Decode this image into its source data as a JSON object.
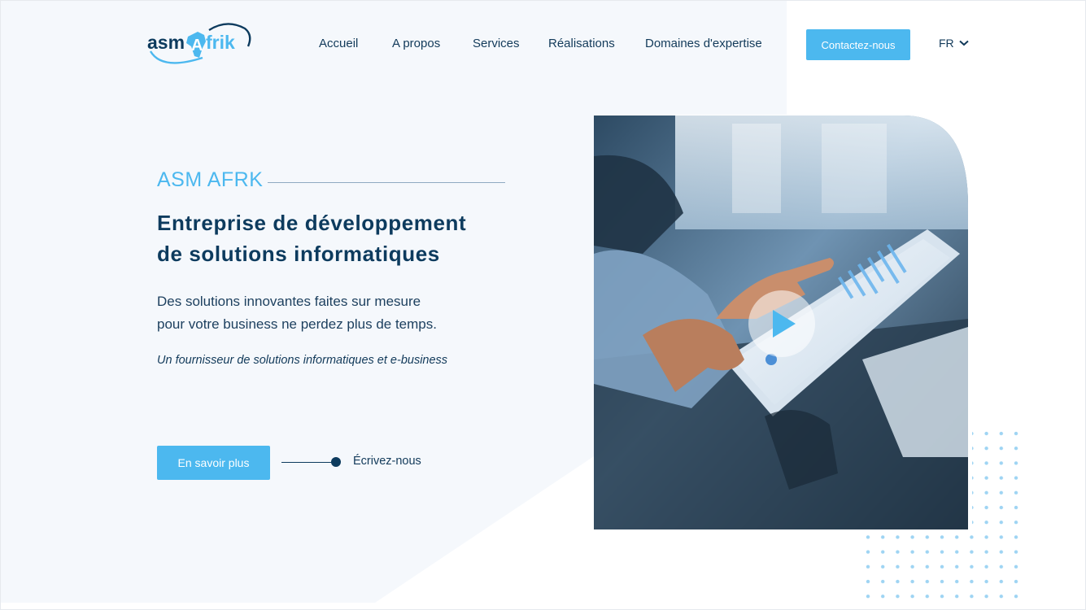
{
  "brand": {
    "logo_text_left": "asm",
    "logo_text_right": "frik",
    "logo_letter_a": "A",
    "colors": {
      "primary": "#4cb8ef",
      "navy": "#0d3b5e",
      "panel": "#f5f8fc"
    }
  },
  "nav": {
    "items": [
      {
        "label": "Accueil"
      },
      {
        "label": "A propos"
      },
      {
        "label": "Services"
      },
      {
        "label": "Réalisations"
      },
      {
        "label": "Domaines d'expertise"
      }
    ],
    "contact_label": "Contactez-nous",
    "lang_label": "FR",
    "lang_icon": "chevron-down-icon"
  },
  "hero": {
    "eyebrow": "ASM AFRK",
    "title_line1": "Entreprise de développement",
    "title_line2": "de solutions informatiques",
    "desc_line1": "Des solutions innovantes faites sur mesure",
    "desc_line2": "pour votre business ne perdez plus de temps.",
    "tagline": "Un fournisseur de solutions informatiques et e-business",
    "more_button": "En savoir plus",
    "write_link": "Écrivez-nous",
    "play_icon": "play-icon"
  }
}
